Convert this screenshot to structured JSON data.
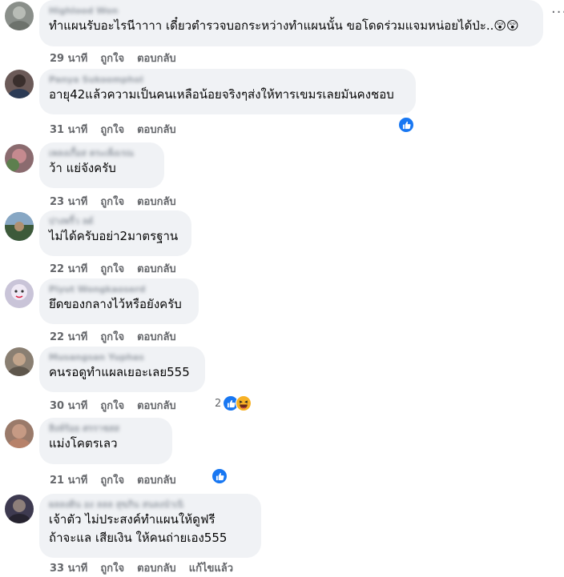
{
  "more_label": "...",
  "comments": [
    {
      "author": "Highlood Won",
      "lines": [
        "ทำแผนรับอะไรนีาาาา เดี๋ยวตำรวจบอกระหว่างทำแผนนั้น ขอโดดร่วมแจมหน่อยได้ป่ะ..😲😲"
      ],
      "time": "29 นาที",
      "like": "ถูกใจ",
      "reply": "ตอบกลับ"
    },
    {
      "author": "Panya Sukoomphol",
      "lines": [
        "อายุ42แล้วความเป็นคนเหลือน้อยจริงๆส่งให้ทารเขมรเลยมันคงชอบ"
      ],
      "time": "31 นาที",
      "like": "ถูกใจ",
      "reply": "ตอบกลับ"
    },
    {
      "author": "เพลงเกื้อส ตระเพ็งเรณ",
      "lines": [
        "ว้า แย่จังครับ"
      ],
      "time": "23 นาที",
      "like": "ถูกใจ",
      "reply": "ตอบกลับ"
    },
    {
      "author": "ปางพริ้ว ลด์",
      "lines": [
        "ไม่ได้ครับอย่า2มาตรฐาน"
      ],
      "time": "22 นาที",
      "like": "ถูกใจ",
      "reply": "ตอบกลับ"
    },
    {
      "author": "Piyut Wongkaoserd",
      "lines": [
        "ยึดของกลางไว้หรือยังครับ"
      ],
      "time": "22 นาที",
      "like": "ถูกใจ",
      "reply": "ตอบกลับ"
    },
    {
      "author": "Musangsan Yuphas",
      "lines": [
        "คนรอดูทำแผลเยอะเลย555"
      ],
      "time": "30 นาที",
      "like": "ถูกใจ",
      "reply": "ตอบกลับ",
      "reaction_count": "2"
    },
    {
      "author": "สิงห์ร้อย ศรราชสส",
      "lines": [
        "แม่งโคตรเลว"
      ],
      "time": "21 นาที",
      "like": "ถูกใจ",
      "reply": "ตอบกลับ"
    },
    {
      "author": "ผลลงดิน อง ลลล สุขภิน สนลงนำเนิ",
      "lines": [
        "เจ้าตัว ไม่ประสงค์ทำแผนให้ดูฟรี",
        "ถ้าจะแล เสียเงิน ให้คนถ่ายเอง555"
      ],
      "time": "33 นาที",
      "like": "ถูกใจ",
      "reply": "ตอบกลับ",
      "edited": "แก้ไขแล้ว"
    }
  ],
  "colors": {
    "bubble": "#f0f2f5",
    "meta_text": "#65676b",
    "like_blue": "#1877f2",
    "haha_yellow": "#f7b125"
  },
  "avatar_colors": [
    "#8a8f8a",
    "#6b5a58",
    "#8b6b6f",
    "#5a7a9a",
    "#c9c4d8",
    "#8a7f72",
    "#9a7a6a",
    "#3e3a50"
  ]
}
